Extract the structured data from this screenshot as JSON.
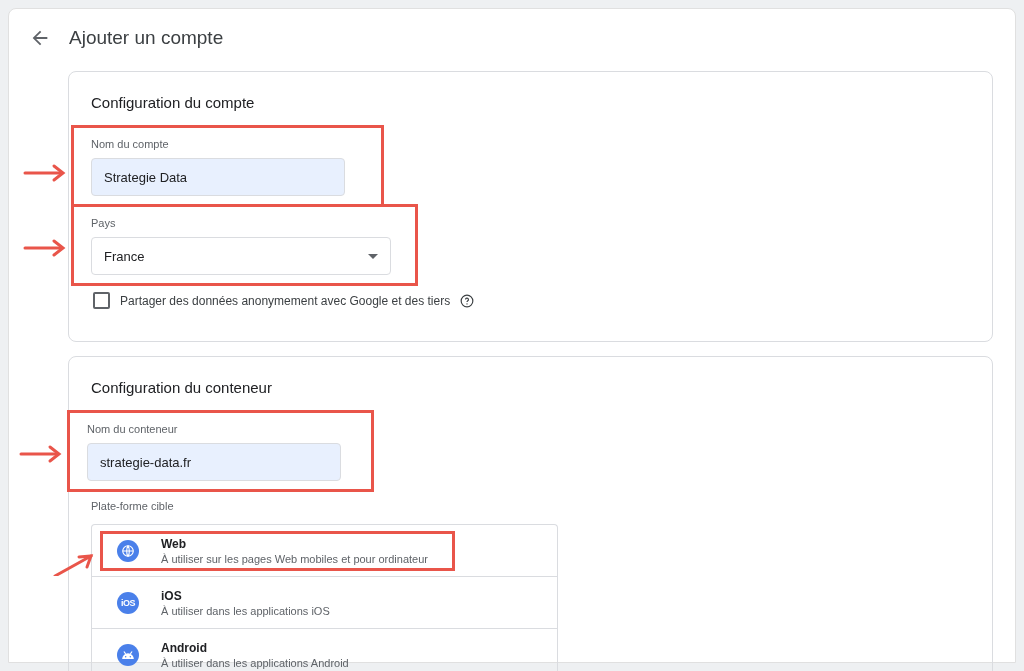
{
  "header": {
    "title": "Ajouter un compte"
  },
  "account_section": {
    "title": "Configuration du compte",
    "account_name": {
      "label": "Nom du compte",
      "value": "Strategie Data",
      "annotated": true
    },
    "country": {
      "label": "Pays",
      "value": "France",
      "annotated": true
    },
    "share_data": {
      "label": "Partager des données anonymement avec Google et des tiers",
      "checked": false
    }
  },
  "container_section": {
    "title": "Configuration du conteneur",
    "container_name": {
      "label": "Nom du conteneur",
      "value": "strategie-data.fr",
      "annotated": true
    },
    "platform_label": "Plate-forme cible",
    "platforms": [
      {
        "kind": "web",
        "name": "Web",
        "description": "À utiliser sur les pages Web mobiles et pour ordinateur",
        "annotated": true
      },
      {
        "kind": "ios",
        "icon_text": "iOS",
        "name": "iOS",
        "description": "À utiliser dans les applications iOS",
        "annotated": false
      },
      {
        "kind": "android",
        "name": "Android",
        "description": "À utiliser dans les applications Android",
        "annotated": false
      }
    ]
  }
}
